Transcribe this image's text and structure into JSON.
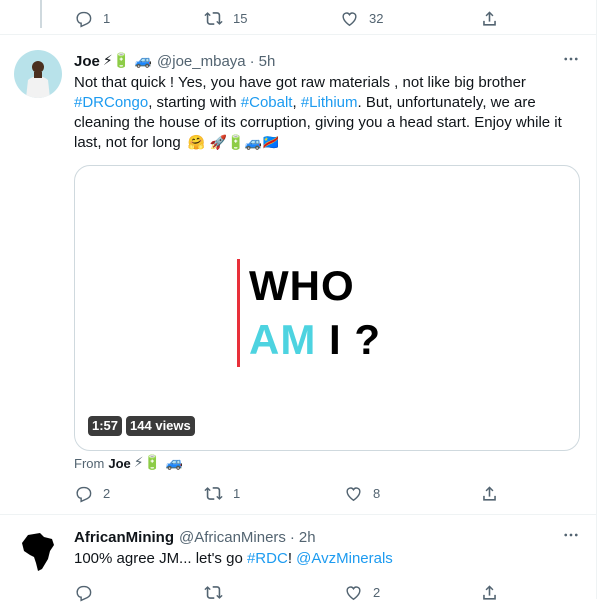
{
  "top_actions": {
    "reply_count": "1",
    "retweet_count": "15",
    "like_count": "32"
  },
  "tweet1": {
    "name": "Joe",
    "name_emojis": "⚡🔋 🚙",
    "handle": "@joe_mbaya",
    "dot": "·",
    "time": "5h",
    "text": {
      "p1": "Not that quick ! Yes, you have got raw materials , not like big brother ",
      "tag1": "#DRCongo",
      "p2": ", starting with ",
      "tag2": "#Cobalt",
      "p3": ", ",
      "tag3": "#Lithium",
      "p4": ". But, unfortunately, we are cleaning the house of its corruption, giving you a head start. Enjoy while it last, not for long ",
      "emojis": "🤗 🚀🔋🚙🇨🇩"
    },
    "media": {
      "line1": "WHO",
      "line2_accent": "AM",
      "line2_rest": " I ?",
      "duration": "1:57",
      "views": "144 views",
      "accent_color": "#4dd3e0",
      "bar_color": "#e8303a"
    },
    "from_label": "From",
    "from_name": "Joe",
    "from_emojis": "⚡🔋 🚙",
    "actions": {
      "reply_count": "2",
      "retweet_count": "1",
      "like_count": "8"
    }
  },
  "tweet2": {
    "name": "AfricanMining",
    "handle": "@AfricanMiners",
    "dot": "·",
    "time": "2h",
    "text": {
      "p1": "100% agree JM... let's go ",
      "tag1": "#RDC",
      "p2": "! ",
      "mention": "@AvzMinerals"
    },
    "actions": {
      "reply_count": "",
      "retweet_count": "",
      "like_count": "2"
    }
  },
  "colors": {
    "link": "#1d9bf0",
    "muted": "#536471",
    "border": "#eff3f4"
  },
  "icons": [
    "reply-icon",
    "retweet-icon",
    "like-icon",
    "share-icon",
    "more-icon"
  ]
}
